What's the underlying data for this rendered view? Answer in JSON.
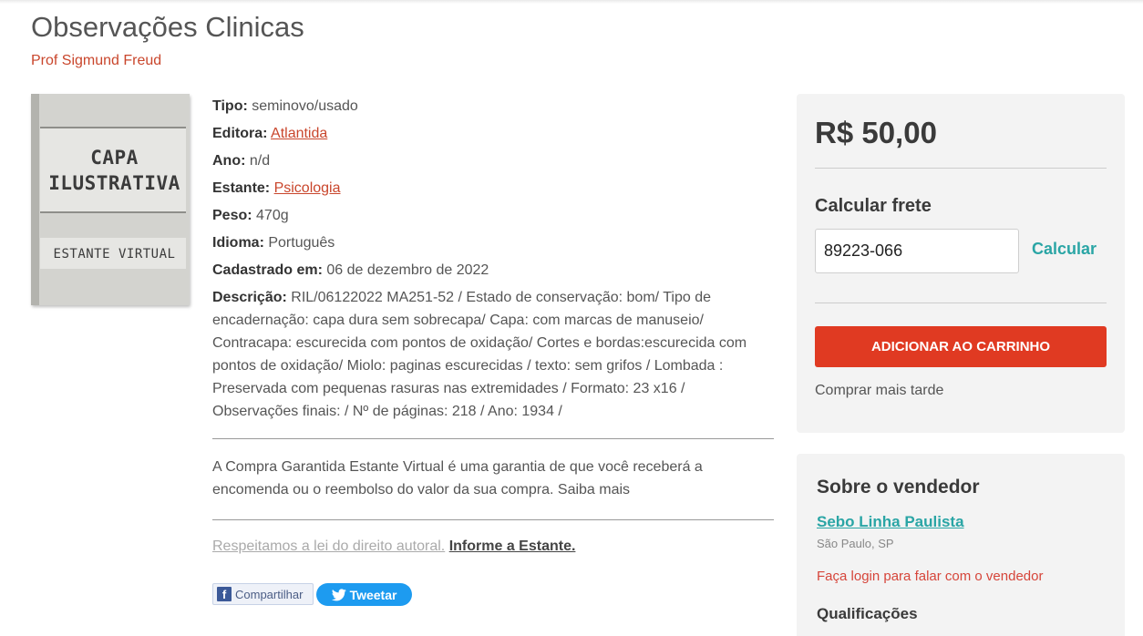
{
  "book": {
    "title": "Observações Clinicas",
    "author": "Prof Sigmund Freud",
    "cover": {
      "line1": "CAPA",
      "line2": "ILUSTRATIVA",
      "brand": "ESTANTE VIRTUAL"
    }
  },
  "details": {
    "tipo": {
      "label": "Tipo:",
      "value": "seminovo/usado"
    },
    "editora": {
      "label": "Editora:",
      "value": "Atlantida"
    },
    "ano": {
      "label": "Ano:",
      "value": "n/d"
    },
    "estante": {
      "label": "Estante:",
      "value": "Psicologia"
    },
    "peso": {
      "label": "Peso:",
      "value": "470g"
    },
    "idioma": {
      "label": "Idioma:",
      "value": "Português"
    },
    "cadastrado": {
      "label": "Cadastrado em:",
      "value": "06 de dezembro de 2022"
    },
    "descricao": {
      "label": "Descrição:",
      "value": "RIL/06122022 MA251-52 / Estado de conservação: bom/ Tipo de encadernação: capa dura sem sobrecapa/ Capa: com marcas de manuseio/ Contracapa: escurecida com pontos de oxidação/ Cortes e bordas:escurecida com pontos de oxidação/ Miolo: paginas escurecidas / texto: sem grifos / Lombada : Preservada com pequenas rasuras nas extremidades / Formato: 23 x16 / Observações finais: / Nº de páginas: 218 / Ano: 1934 /"
    }
  },
  "guarantee": "A Compra Garantida Estante Virtual é uma garantia de que você receberá a encomenda ou o reembolso do valor da sua compra. Saiba mais",
  "copyright": {
    "text": "Respeitamos a lei do direito autoral.",
    "link": "Informe a Estante."
  },
  "share": {
    "facebook": "Compartilhar",
    "twitter": "Tweetar"
  },
  "purchase": {
    "price": "R$ 50,00",
    "frete_label": "Calcular frete",
    "cep_value": "89223-066",
    "calc_label": "Calcular",
    "add_cart": "ADICIONAR AO CARRINHO",
    "later": "Comprar mais tarde"
  },
  "seller": {
    "heading": "Sobre o vendedor",
    "name": "Sebo Linha Paulista",
    "location": "São Paulo, SP",
    "login": "Faça login para falar com o vendedor",
    "qualificacoes": "Qualificações"
  },
  "colors": {
    "accent": "#c9462c",
    "cart_button": "#e03a22",
    "teal_link": "#2aa5a5",
    "twitter": "#1d9bf0"
  }
}
